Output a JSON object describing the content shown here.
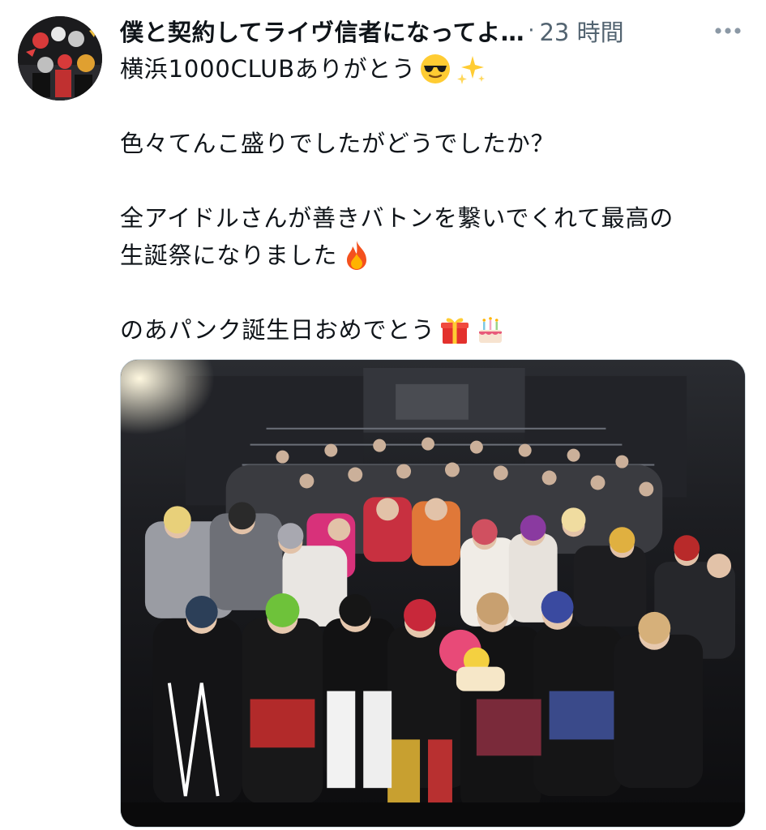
{
  "tweet": {
    "author_name": "僕と契約してライヴ信者になってよ…",
    "separator": "·",
    "timestamp": "23 時間",
    "lines": [
      {
        "text": "横浜1000CLUBありがとう",
        "emojis": [
          "sunglasses-emoji",
          "sparkles-emoji"
        ]
      },
      {
        "text": "",
        "emojis": []
      },
      {
        "text": "色々てんこ盛りでしたがどうでしたか？",
        "emojis": []
      },
      {
        "text": "",
        "emojis": []
      },
      {
        "text": "全アイドルさんが善きバトンを繋いでくれて最高の",
        "emojis": []
      },
      {
        "text": "生誕祭になりました",
        "emojis": [
          "fire-emoji"
        ]
      },
      {
        "text": "",
        "emojis": []
      },
      {
        "text": "のあパンク誕生日おめでとう",
        "emojis": [
          "gift-emoji",
          "cake-emoji"
        ]
      }
    ]
  },
  "colors": {
    "text_primary": "#0f1419",
    "text_secondary": "#536471",
    "border": "#cfd9de"
  }
}
